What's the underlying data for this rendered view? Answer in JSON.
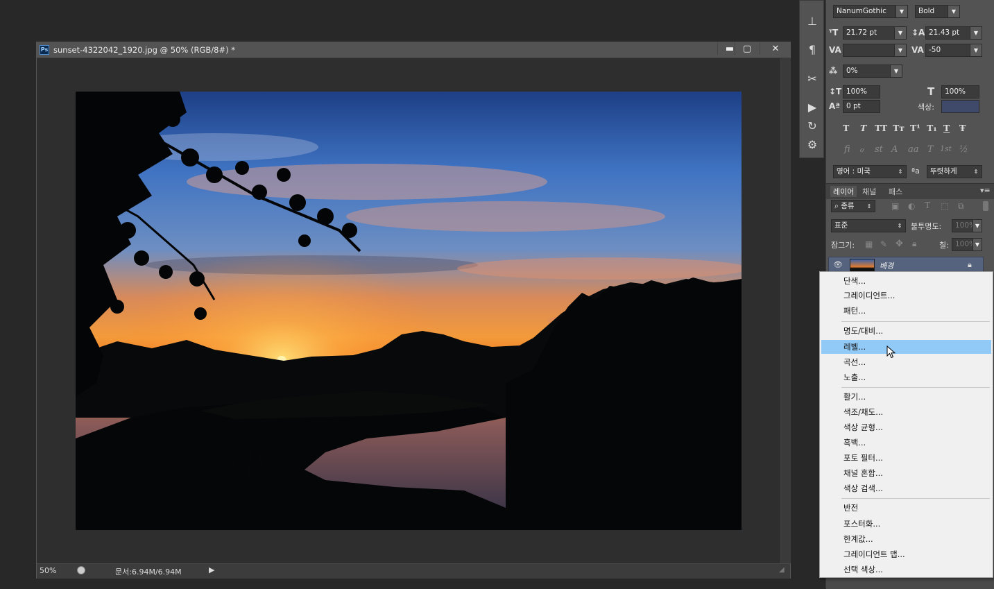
{
  "document": {
    "title": "sunset-4322042_1920.jpg @ 50% (RGB/8#) *",
    "app_badge": "Ps",
    "window_buttons": {
      "minimize": "▬",
      "maximize": "▢",
      "close": "✕"
    },
    "status": {
      "zoom": "50%",
      "doc_size": "문서:6.94M/6.94M",
      "arrow": "▶"
    }
  },
  "character_panel": {
    "font_family": "NanumGothic",
    "font_style": "Bold",
    "font_size": "21.72 pt",
    "leading": "21.43 pt",
    "kerning": "",
    "tracking": "-50",
    "tsume": "0%",
    "vertical_scale": "100%",
    "horizontal_scale": "100%",
    "baseline_shift": "0 pt",
    "color_label": "색상:",
    "color_swatch": "#3f4a6a",
    "style_buttons": [
      "T",
      "T",
      "TT",
      "Tт",
      "T¹",
      "T₁",
      "T",
      "Ŧ"
    ],
    "opentype_buttons": [
      "ﬁ",
      "ℴ",
      "st",
      "A",
      "aa",
      "T",
      "1st",
      "½"
    ],
    "language": "영어 : 미국",
    "aa_label": "ªa",
    "antialias": "뚜렷하게"
  },
  "layers_panel": {
    "tabs": [
      "레이어",
      "채널",
      "패스"
    ],
    "filter_kind": "종류",
    "blend_mode": "표준",
    "opacity_label": "불투명도:",
    "opacity_value": "100%",
    "lock_label": "잠그기:",
    "fill_label": "칠:",
    "fill_value": "100%",
    "layer_name": "배경"
  },
  "context_menu": {
    "groups": [
      [
        "단색...",
        "그레이디언트...",
        "패턴..."
      ],
      [
        "명도/대비...",
        "레벨...",
        "곡선...",
        "노출..."
      ],
      [
        "활기...",
        "색조/채도...",
        "색상 균형...",
        "흑백...",
        "포토 필터...",
        "채널 혼합...",
        "색상 검색..."
      ],
      [
        "반전",
        "포스터화...",
        "한계값...",
        "그레이디언트 맵...",
        "선택 색상..."
      ]
    ],
    "highlighted": "레벨..."
  },
  "colors": {
    "menu_highlight": "#91c9f7",
    "panel_bg": "#535353",
    "canvas_bg": "#2e2e2e"
  }
}
